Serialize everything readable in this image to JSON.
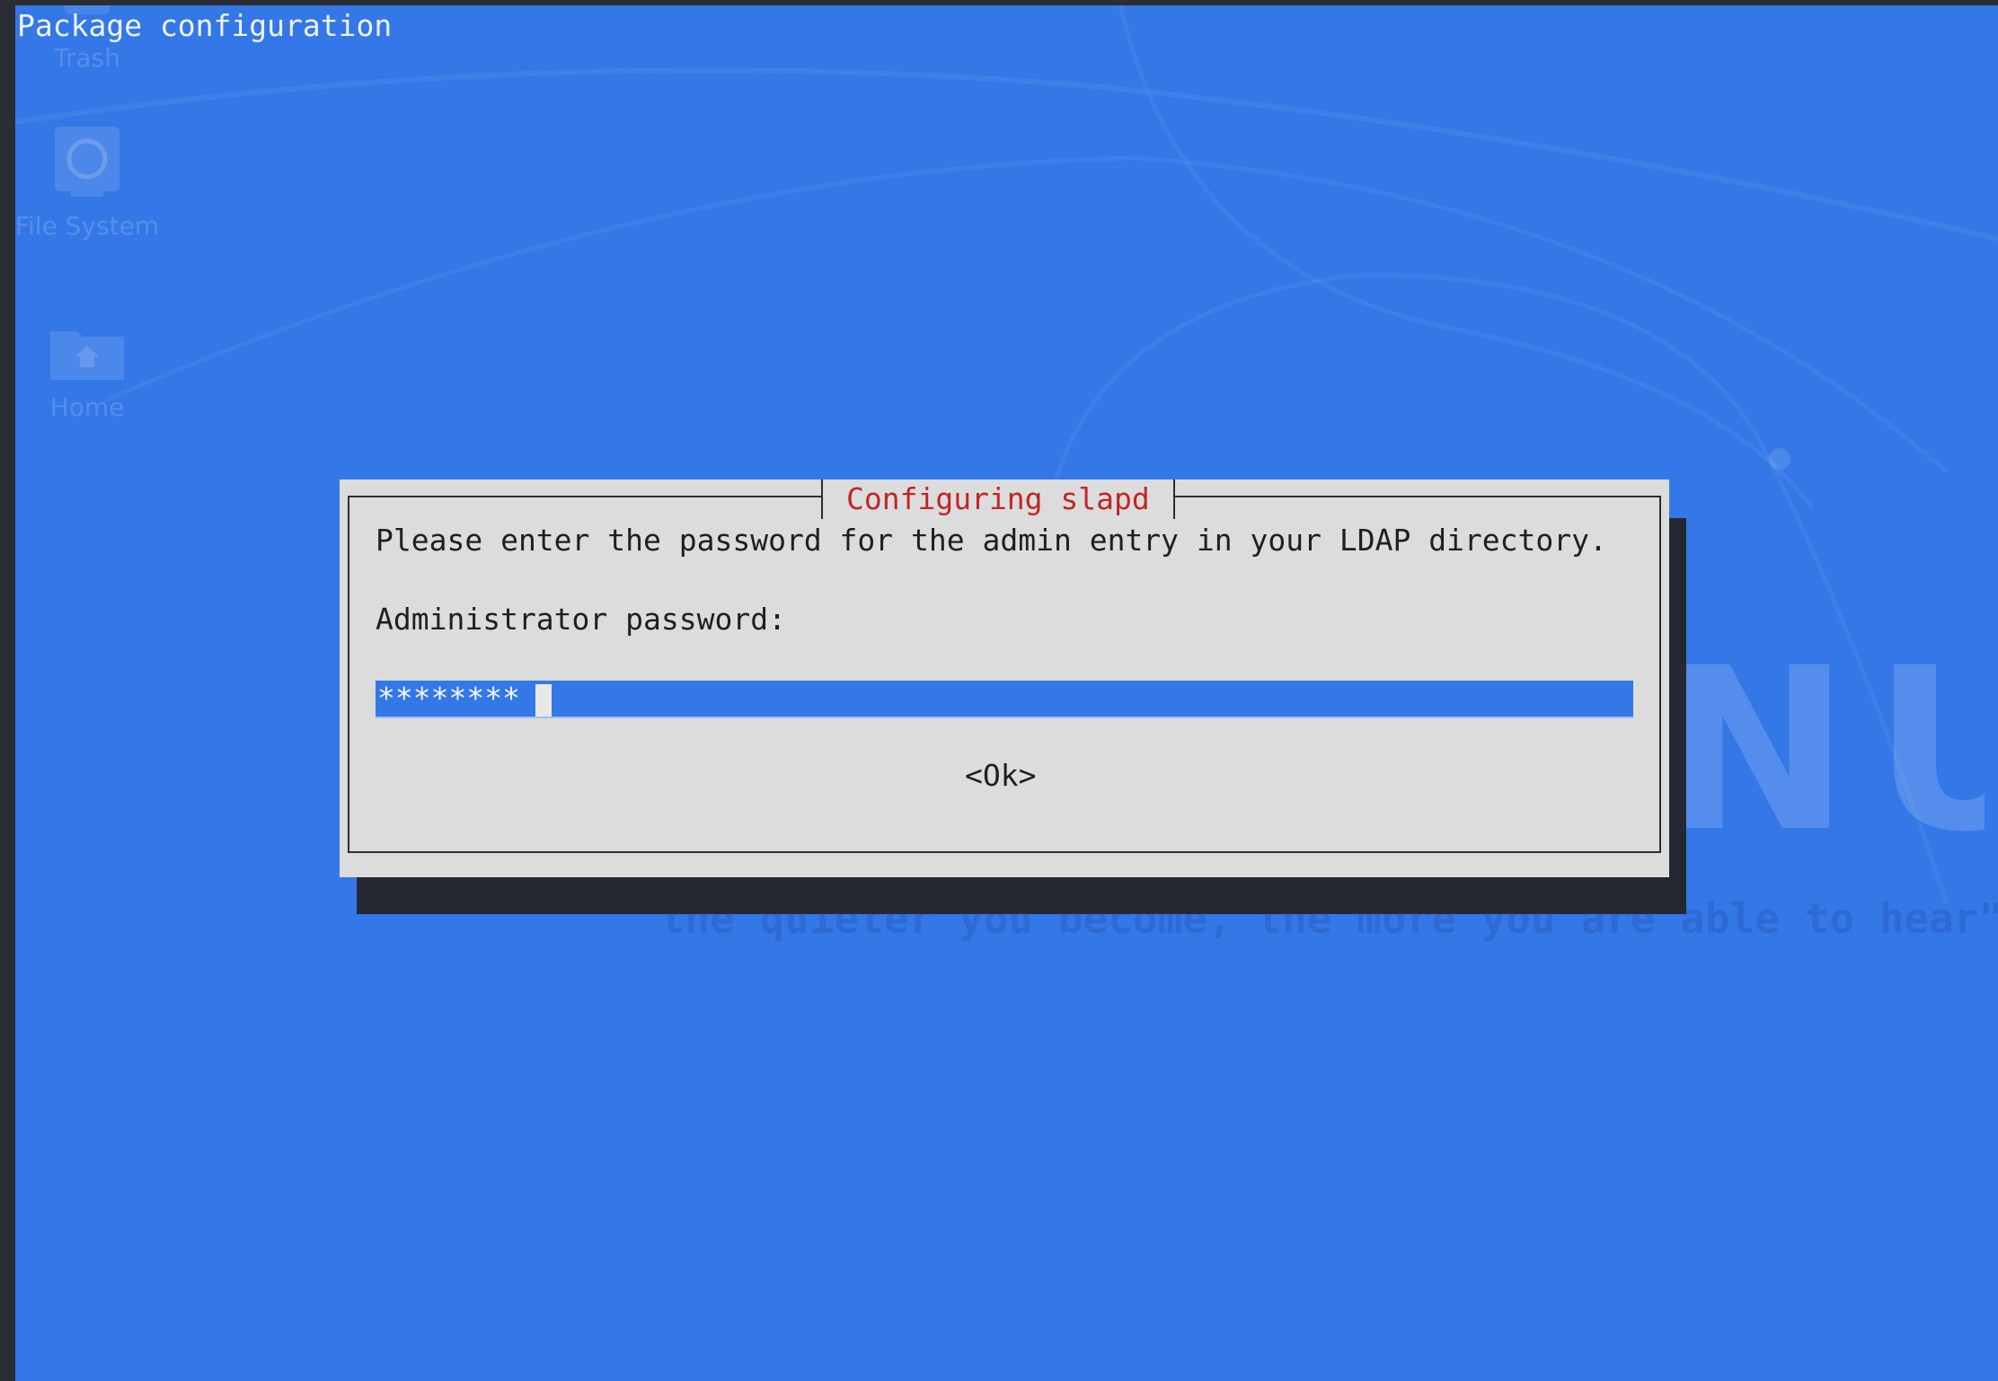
{
  "window": {
    "title": "Package configuration"
  },
  "desktop": {
    "icons": [
      {
        "label": "Trash",
        "icon": "trash-icon"
      },
      {
        "label": "File System",
        "icon": "hard-drive-icon"
      },
      {
        "label": "Home",
        "icon": "home-folder-icon"
      }
    ],
    "wallpaper": {
      "brand": "KALI LINUX",
      "tagline": "\"the quieter you become, the more you are able to hear\""
    }
  },
  "dialog": {
    "title": "Configuring slapd",
    "prompt": "Please enter the password for the admin entry in your LDAP directory.",
    "field_label": "Administrator password:",
    "password_value": "********",
    "ok_label": "<Ok>"
  },
  "colors": {
    "screen_bg": "#3478e7",
    "dialog_bg": "#dcdcdc",
    "dialog_title": "#c02626",
    "input_bg": "#3478e7",
    "frame": "#2b2d35"
  }
}
